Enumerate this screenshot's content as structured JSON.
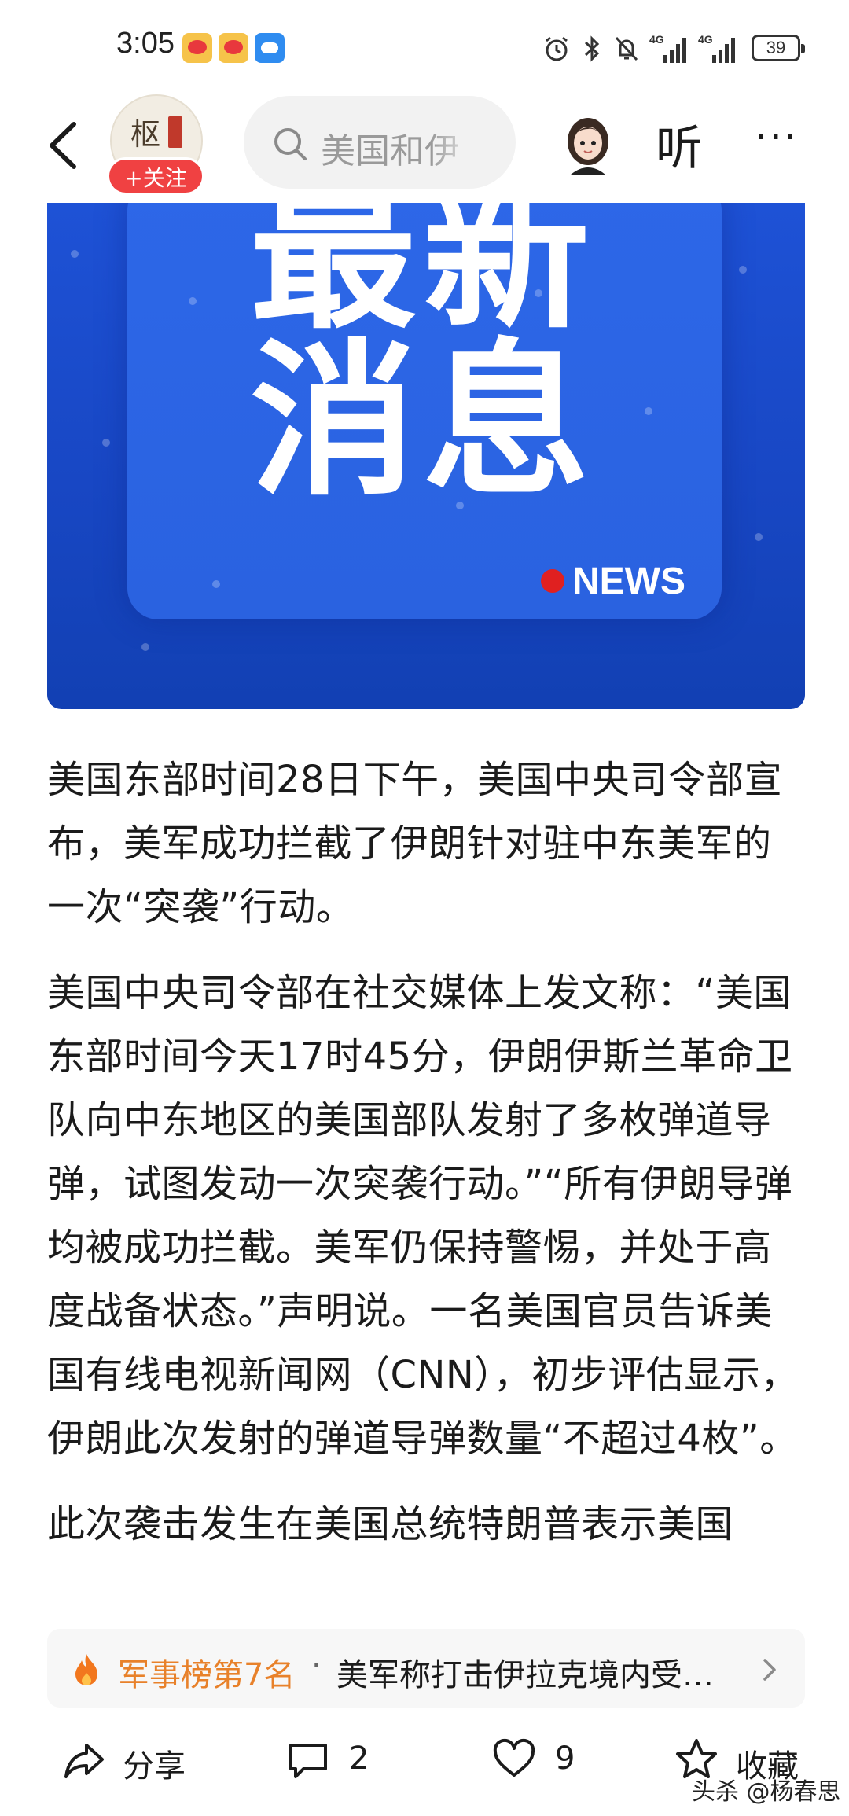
{
  "status_bar": {
    "time": "3:05",
    "battery": "39",
    "network_1": "4G",
    "network_2": "4G"
  },
  "header": {
    "follow_label": "+关注",
    "search_text": "美国和伊",
    "listen_label": "听",
    "more_label": "···"
  },
  "hero": {
    "line1": "最新",
    "line2": "消息",
    "badge": "NEWS"
  },
  "article": {
    "paragraphs": [
      "美国东部时间28日下午，美国中央司令部宣布，美军成功拦截了伊朗针对驻中东美军的一次“突袭”行动。",
      "美国中央司令部在社交媒体上发文称：“美国东部时间今天17时45分，伊朗伊斯兰革命卫队向中东地区的美国部队发射了多枚弹道导弹，试图发动一次突袭行动。”“所有伊朗导弹均被成功拦截。美军仍保持警惕，并处于高度战备状态。”声明说。一名美国官员告诉美国有线电视新闻网（CNN），初步评估显示，伊朗此次发射的弹道导弹数量“不超过4枚”。",
      "此次袭击发生在美国总统特朗普表示美国"
    ]
  },
  "hot_bar": {
    "rank": "军事榜第7名",
    "separator": "·",
    "title": "美军称打击伊拉克境内受…",
    "accent_color": "#e8812a"
  },
  "bottom_bar": {
    "share_label": "分享",
    "comment_count": "2",
    "like_count": "9",
    "favorite_label": "收藏"
  },
  "watermark": "头杀 @杨春思"
}
